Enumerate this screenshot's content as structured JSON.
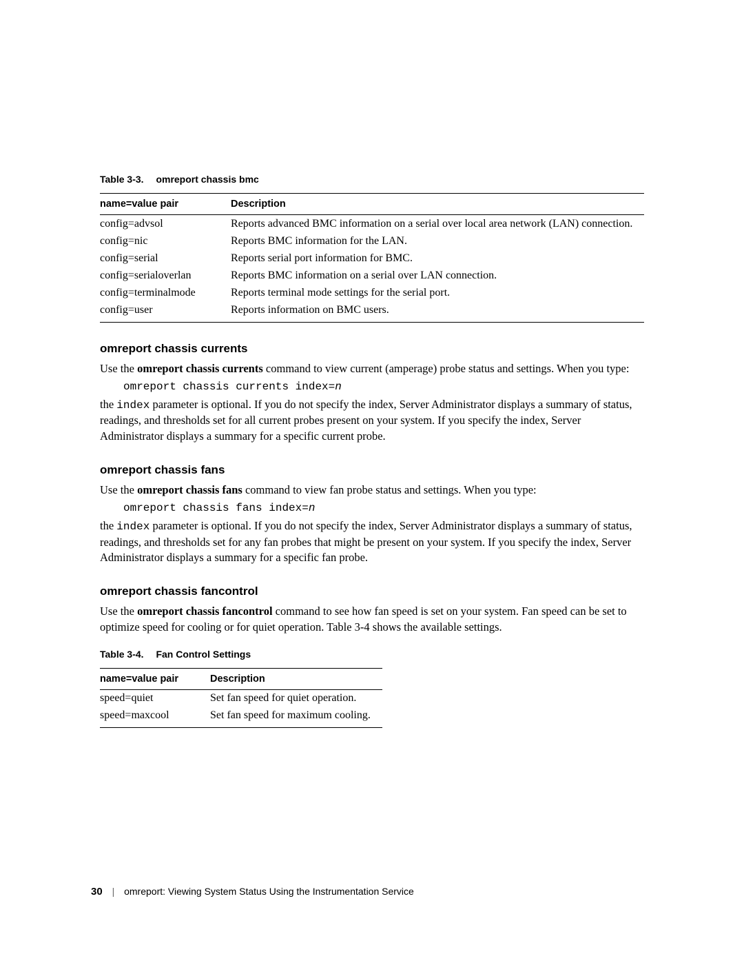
{
  "table3_3": {
    "caption_num": "Table 3-3.",
    "caption_title": "omreport chassis bmc",
    "head_col1": "name=value pair",
    "head_col2": "Description",
    "rows": [
      {
        "name": "config=advsol",
        "desc": "Reports advanced BMC information on a serial over local area network (LAN) connection."
      },
      {
        "name": "config=nic",
        "desc": "Reports BMC information for the LAN."
      },
      {
        "name": "config=serial",
        "desc": "Reports serial port information for BMC."
      },
      {
        "name": "config=serialoverlan",
        "desc": "Reports BMC information on a serial over LAN connection."
      },
      {
        "name": "config=terminalmode",
        "desc": "Reports terminal mode settings for the serial port."
      },
      {
        "name": "config=user",
        "desc": "Reports information on BMC users."
      }
    ]
  },
  "section_currents": {
    "title": "omreport chassis currents",
    "p1_a": "Use the ",
    "p1_b": "omreport chassis currents",
    "p1_c": " command to view current (amperage) probe status and settings. When you type:",
    "code_a": "omreport chassis currents index=",
    "code_b": "n",
    "p2_a": "the ",
    "p2_code": "index",
    "p2_b": " parameter is optional. If you do not specify the index, Server Administrator displays a summary of status, readings, and thresholds set for all current probes present on your system. If you specify the index, Server Administrator displays a summary for a specific current probe."
  },
  "section_fans": {
    "title": "omreport chassis fans",
    "p1_a": "Use the ",
    "p1_b": "omreport chassis fans",
    "p1_c": " command to view fan probe status and settings. When you type:",
    "code_a": "omreport chassis fans index=",
    "code_b": "n",
    "p2_a": "the ",
    "p2_code": "index",
    "p2_b": " parameter is optional. If you do not specify the index, Server Administrator displays a summary of status, readings, and thresholds set for any fan probes that might be present on your system. If you specify the index, Server Administrator displays a summary for a specific fan probe."
  },
  "section_fancontrol": {
    "title": "omreport chassis fancontrol",
    "p1_a": "Use the ",
    "p1_b": "omreport chassis fancontrol",
    "p1_c": " command to see how fan speed is set on your system. Fan speed can be set to optimize speed for cooling or for quiet operation. Table 3-4 shows the available settings."
  },
  "table3_4": {
    "caption_num": "Table 3-4.",
    "caption_title": "Fan Control Settings",
    "head_col1": "name=value pair",
    "head_col2": "Description",
    "rows": [
      {
        "name": "speed=quiet",
        "desc": "Set fan speed for quiet operation."
      },
      {
        "name": "speed=maxcool",
        "desc": "Set fan speed for maximum cooling."
      }
    ]
  },
  "footer": {
    "page": "30",
    "text": "omreport: Viewing System Status Using the Instrumentation Service"
  }
}
